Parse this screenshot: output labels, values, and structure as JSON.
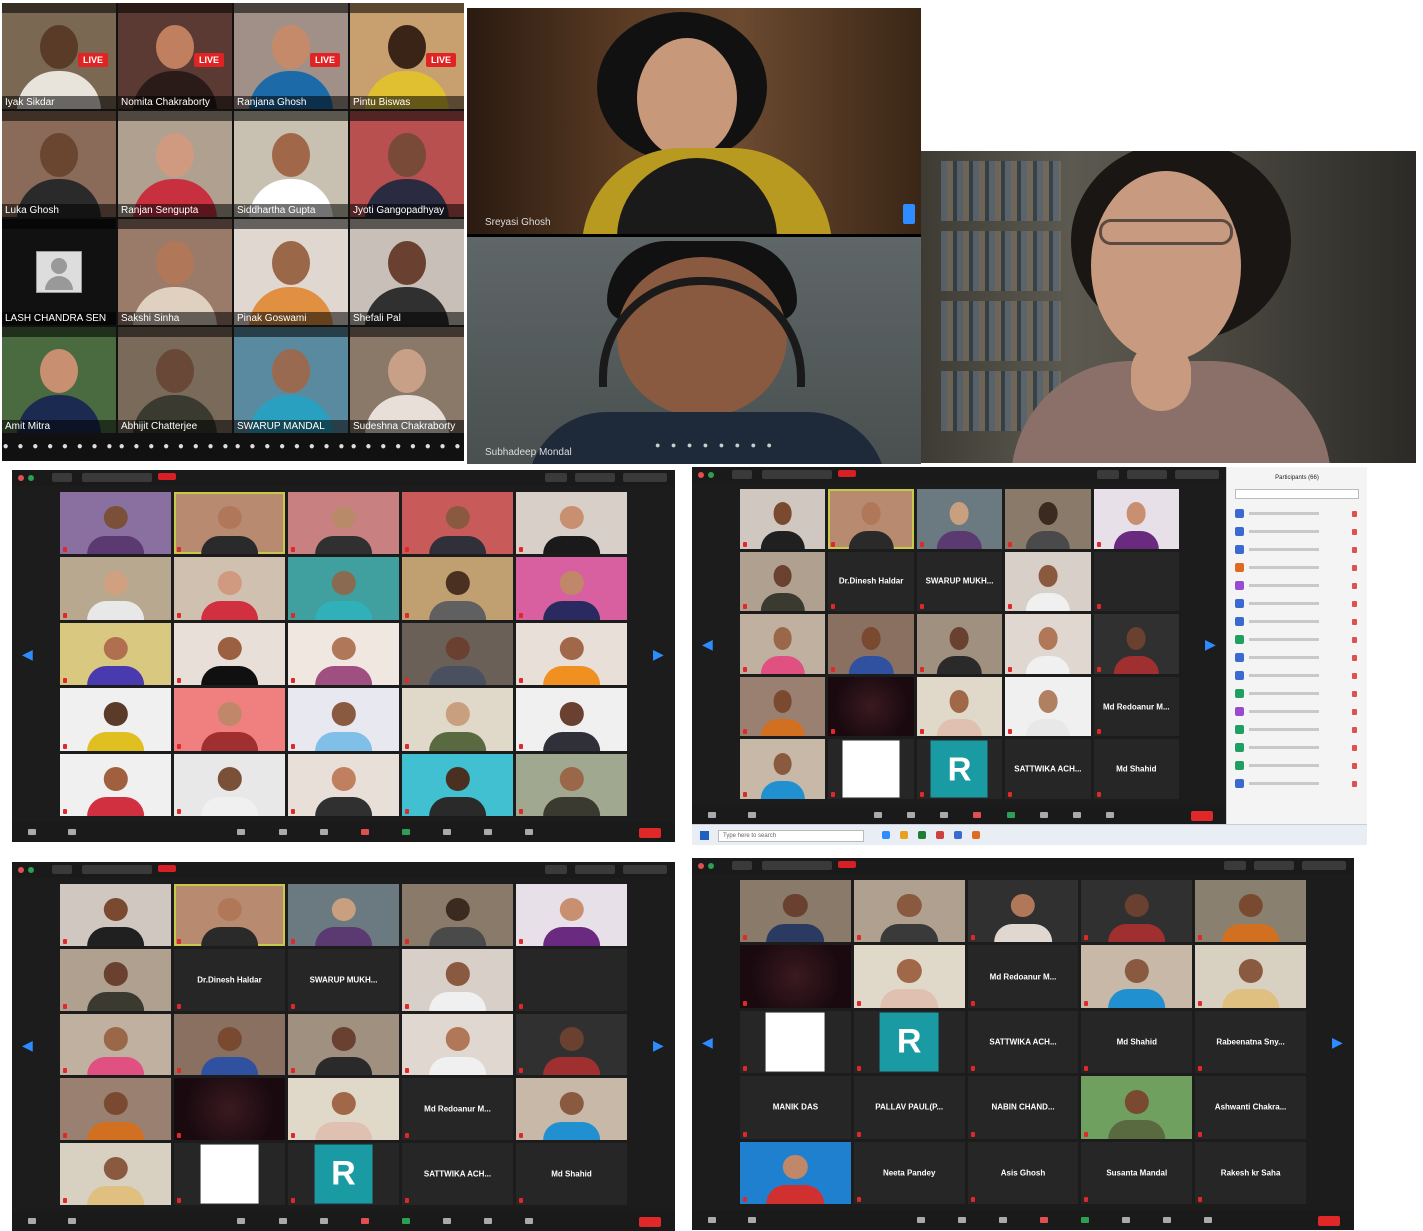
{
  "mobile_grid": {
    "tiles": [
      {
        "name": "Iyak Sikdar",
        "live": "LIVE",
        "bg": "#7a6852",
        "skin": "#5a3b28",
        "shirt": "#e8e4dc"
      },
      {
        "name": "Nomita Chakraborty",
        "live": "LIVE",
        "bg": "#5a3a32",
        "skin": "#c08060",
        "shirt": "#2a1a18"
      },
      {
        "name": "Ranjana Ghosh",
        "live": "LIVE",
        "bg": "#a09088",
        "skin": "#c58a6a",
        "shirt": "#1c6aa8"
      },
      {
        "name": "Pintu Biswas",
        "live": "LIVE",
        "bg": "#c8a070",
        "skin": "#3a2418",
        "shirt": "#e0c030"
      },
      {
        "name": "Luka Ghosh",
        "live": "",
        "bg": "#8a6a58",
        "skin": "#6a4530",
        "shirt": "#2a2a2a"
      },
      {
        "name": "Ranjan Sengupta",
        "live": "",
        "bg": "#b0a090",
        "skin": "#d09a80",
        "shirt": "#c83040"
      },
      {
        "name": "Siddhartha Gupta",
        "live": "",
        "bg": "#c8c0b0",
        "skin": "#a06848",
        "shirt": "#ffffff"
      },
      {
        "name": "Jyoti Gangopadhyay",
        "live": "",
        "bg": "#b85050",
        "skin": "#7a4a38",
        "shirt": "#2a2a40"
      },
      {
        "name": "LASH CHANDRA SEN",
        "live": "",
        "bg": "#111111",
        "skin": "",
        "shirt": "",
        "avatar": true
      },
      {
        "name": "Sakshi Sinha",
        "live": "",
        "bg": "#9a7a68",
        "skin": "#b07858",
        "shirt": "#e0d0c0"
      },
      {
        "name": "Pinak Goswami",
        "live": "",
        "bg": "#e0d8d0",
        "skin": "#9a6848",
        "shirt": "#e09040"
      },
      {
        "name": "Shefali Pal",
        "live": "",
        "bg": "#c8c0b8",
        "skin": "#6a4030",
        "shirt": "#303030"
      },
      {
        "name": "Amit Mitra",
        "live": "",
        "bg": "#4a6a40",
        "skin": "#c89070",
        "shirt": "#1a2a50"
      },
      {
        "name": "Abhijit Chatterjee",
        "live": "",
        "bg": "#7a6a5a",
        "skin": "#6a4838",
        "shirt": "#3a3a30"
      },
      {
        "name": "SWARUP MANDAL",
        "live": "",
        "bg": "#5a8aa0",
        "skin": "#9a6a50",
        "shirt": "#2aa0c0"
      },
      {
        "name": "Sudeshna Chakraborty",
        "live": "",
        "bg": "#8a7868",
        "skin": "#c8a088",
        "shirt": "#e8e0d8"
      }
    ],
    "footer_dots": [
      "● ● ● ● ● ● ● ● ●",
      "● ● ● ● ● ● ● ● ●",
      "● ● ● ● ● ● ● ● ●",
      "● ● ● ● ● ● ● ● ●"
    ]
  },
  "speakers": {
    "top_name": "Sreyasi Ghosh",
    "bottom_name": "Subhadeep Mondal",
    "bottom_dots": "● ● ● ● ● ● ● ●"
  },
  "zoom_panels": [
    {
      "cols": 5,
      "rows": 5,
      "tiles": [
        {
          "type": "video",
          "bg": "#8a70a0",
          "skin": "#7a5038",
          "shirt": "#5a3a70"
        },
        {
          "type": "video",
          "bg": "#b88a70",
          "skin": "#b07858",
          "shirt": "#2a2a2a",
          "active": true
        },
        {
          "type": "video",
          "bg": "#c88080",
          "skin": "#b88a6a",
          "shirt": "#303030"
        },
        {
          "type": "video",
          "bg": "#c85a5a",
          "skin": "#8a5a40",
          "shirt": "#30303a"
        },
        {
          "type": "video",
          "bg": "#d8d0c8",
          "skin": "#c89070",
          "shirt": "#1a1a1a"
        },
        {
          "type": "video",
          "bg": "#b8a890",
          "skin": "#d0a080",
          "shirt": "#e8e8e8"
        },
        {
          "type": "video",
          "bg": "#d0c0b0",
          "skin": "#d09a80",
          "shirt": "#d03040"
        },
        {
          "type": "video",
          "bg": "#40a0a0",
          "skin": "#8a6a50",
          "shirt": "#30b0b8"
        },
        {
          "type": "video",
          "bg": "#c0a070",
          "skin": "#4a3020",
          "shirt": "#606060"
        },
        {
          "type": "video",
          "bg": "#d860a0",
          "skin": "#c08868",
          "shirt": "#2a2a60"
        },
        {
          "type": "video",
          "bg": "#d8c880",
          "skin": "#b07050",
          "shirt": "#4a3ab0"
        },
        {
          "type": "video",
          "bg": "#e8e0d8",
          "skin": "#9a6040",
          "shirt": "#101010"
        },
        {
          "type": "video",
          "bg": "#f0e8e0",
          "skin": "#b07858",
          "shirt": "#a05080"
        },
        {
          "type": "video",
          "bg": "#6a6058",
          "skin": "#6a4030",
          "shirt": "#4a5060"
        },
        {
          "type": "video",
          "bg": "#e8e0d8",
          "skin": "#a06848",
          "shirt": "#f09020"
        },
        {
          "type": "video",
          "bg": "#f0f0f0",
          "skin": "#5a3a28",
          "shirt": "#e0c020"
        },
        {
          "type": "video",
          "bg": "#f08080",
          "skin": "#c08868",
          "shirt": "#a03030"
        },
        {
          "type": "video",
          "bg": "#e8e8f0",
          "skin": "#8a5a40",
          "shirt": "#80c0e8"
        },
        {
          "type": "video",
          "bg": "#e0d8c8",
          "skin": "#c8a080",
          "shirt": "#5a6a40"
        },
        {
          "type": "video",
          "bg": "#f0f0f0",
          "skin": "#6a4030",
          "shirt": "#30303a"
        },
        {
          "type": "video",
          "bg": "#f0f0f0",
          "skin": "#a06040",
          "shirt": "#d03040"
        },
        {
          "type": "video",
          "bg": "#e8e8e8",
          "skin": "#7a5038",
          "shirt": "#f0f0f0"
        },
        {
          "type": "video",
          "bg": "#e8e0d8",
          "skin": "#c08060",
          "shirt": "#303030"
        },
        {
          "type": "video",
          "bg": "#40c0d0",
          "skin": "#4a3020",
          "shirt": "#2a2a2a"
        },
        {
          "type": "video",
          "bg": "#a0a890",
          "skin": "#9a6848",
          "shirt": "#3a3a30"
        }
      ]
    },
    {
      "cols": 5,
      "rows": 5,
      "side_panel": true,
      "tiles": [
        {
          "type": "video",
          "bg": "#d0c8c0",
          "skin": "#7a4a30",
          "shirt": "#202020"
        },
        {
          "type": "video",
          "bg": "#b88a70",
          "skin": "#b07858",
          "shirt": "#2a2a2a",
          "active": true
        },
        {
          "type": "video",
          "bg": "#6a7a80",
          "skin": "#c8a080",
          "shirt": "#5a3a70"
        },
        {
          "type": "video",
          "bg": "#8a7a6a",
          "skin": "#3a2a20",
          "shirt": "#4a4a4a"
        },
        {
          "type": "video",
          "bg": "#e8e0e8",
          "skin": "#c89070",
          "shirt": "#6a2a80"
        },
        {
          "type": "video",
          "bg": "#b0a090",
          "skin": "#6a4030",
          "shirt": "#3a3a30"
        },
        {
          "type": "name",
          "label": "Dr.Dinesh Haldar"
        },
        {
          "type": "name",
          "label": "SWARUP MUKH..."
        },
        {
          "type": "video",
          "bg": "#d8d0c8",
          "skin": "#8a5a40",
          "shirt": "#f0f0f0"
        },
        {
          "type": "empty"
        },
        {
          "type": "video",
          "bg": "#c0b0a0",
          "skin": "#9a6848",
          "shirt": "#e05080"
        },
        {
          "type": "video",
          "bg": "#8a7060",
          "skin": "#7a4a30",
          "shirt": "#3050a0"
        },
        {
          "type": "video",
          "bg": "#a09080",
          "skin": "#6a4030",
          "shirt": "#2a2a2a"
        },
        {
          "type": "video",
          "bg": "#e0d8d0",
          "skin": "#b07858",
          "shirt": "#f0f0f0"
        },
        {
          "type": "video",
          "bg": "#303030",
          "skin": "#6a4030",
          "shirt": "#a03030"
        },
        {
          "type": "video",
          "bg": "#9a8070",
          "skin": "#7a4a30",
          "shirt": "#d07020"
        },
        {
          "type": "dark"
        },
        {
          "type": "video",
          "bg": "#e0d8c8",
          "skin": "#a06848",
          "shirt": "#e0c0b0"
        },
        {
          "type": "video",
          "bg": "#f0f0f0",
          "skin": "#b08060",
          "shirt": "#e8e8e8"
        },
        {
          "type": "name",
          "label": "Md Redoanur M..."
        },
        {
          "type": "video",
          "bg": "#c8b8a8",
          "skin": "#8a5a40",
          "shirt": "#2090d0"
        },
        {
          "type": "white"
        },
        {
          "type": "r",
          "label": "R"
        },
        {
          "type": "name",
          "label": "SATTWIKA ACH..."
        },
        {
          "type": "name",
          "label": "Md Shahid"
        }
      ],
      "panel": {
        "title": "Participants (66)",
        "search_placeholder": "Find a participant",
        "rows": [
          "#3a6ad0",
          "#3a6ad0",
          "#3a6ad0",
          "#e06a20",
          "#9a4ad0",
          "#3a6ad0",
          "#3a6ad0",
          "#20a060",
          "#3a6ad0",
          "#3a6ad0",
          "#20a060",
          "#9a4ad0",
          "#20a060",
          "#20a060",
          "#20a060",
          "#3a6ad0"
        ]
      },
      "taskbar": {
        "search": "Type here to search",
        "apps": [
          "#2d8cff",
          "#e8a020",
          "#1e7e34",
          "#d04040",
          "#3a6ad0",
          "#e06a20"
        ]
      }
    },
    {
      "cols": 5,
      "rows": 5,
      "tiles": [
        {
          "type": "video",
          "bg": "#d0c8c0",
          "skin": "#7a4a30",
          "shirt": "#202020"
        },
        {
          "type": "video",
          "bg": "#b88a70",
          "skin": "#b07858",
          "shirt": "#2a2a2a",
          "active": true
        },
        {
          "type": "video",
          "bg": "#6a7a80",
          "skin": "#c8a080",
          "shirt": "#5a3a70"
        },
        {
          "type": "video",
          "bg": "#8a7a6a",
          "skin": "#3a2a20",
          "shirt": "#4a4a4a"
        },
        {
          "type": "video",
          "bg": "#e8e0e8",
          "skin": "#c89070",
          "shirt": "#6a2a80"
        },
        {
          "type": "video",
          "bg": "#b0a090",
          "skin": "#6a4030",
          "shirt": "#3a3a30"
        },
        {
          "type": "name",
          "label": "Dr.Dinesh Haldar"
        },
        {
          "type": "name",
          "label": "SWARUP MUKH..."
        },
        {
          "type": "video",
          "bg": "#d8d0c8",
          "skin": "#8a5a40",
          "shirt": "#f0f0f0"
        },
        {
          "type": "empty"
        },
        {
          "type": "video",
          "bg": "#c0b0a0",
          "skin": "#9a6848",
          "shirt": "#e05080"
        },
        {
          "type": "video",
          "bg": "#8a7060",
          "skin": "#7a4a30",
          "shirt": "#3050a0"
        },
        {
          "type": "video",
          "bg": "#a09080",
          "skin": "#6a4030",
          "shirt": "#2a2a2a"
        },
        {
          "type": "video",
          "bg": "#e0d8d0",
          "skin": "#b07858",
          "shirt": "#f0f0f0"
        },
        {
          "type": "video",
          "bg": "#303030",
          "skin": "#6a4030",
          "shirt": "#a03030"
        },
        {
          "type": "video",
          "bg": "#9a8070",
          "skin": "#7a4a30",
          "shirt": "#d07020"
        },
        {
          "type": "dark"
        },
        {
          "type": "video",
          "bg": "#e0d8c8",
          "skin": "#a06848",
          "shirt": "#e0c0b0"
        },
        {
          "type": "name",
          "label": "Md Redoanur M..."
        },
        {
          "type": "video",
          "bg": "#c8b8a8",
          "skin": "#8a5a40",
          "shirt": "#2090d0"
        },
        {
          "type": "video",
          "bg": "#d8d0c0",
          "skin": "#8a5a40",
          "shirt": "#e0c080"
        },
        {
          "type": "white"
        },
        {
          "type": "r",
          "label": "R"
        },
        {
          "type": "name",
          "label": "SATTWIKA ACH..."
        },
        {
          "type": "name",
          "label": "Md Shahid"
        }
      ]
    },
    {
      "cols": 5,
      "rows": 5,
      "tiles": [
        {
          "type": "video",
          "bg": "#8a7a6a",
          "skin": "#6a4030",
          "shirt": "#2a3a60"
        },
        {
          "type": "video",
          "bg": "#b0a090",
          "skin": "#8a5a40",
          "shirt": "#3a3a3a"
        },
        {
          "type": "video",
          "bg": "#303030",
          "skin": "#b07858",
          "shirt": "#e0d8d0"
        },
        {
          "type": "video",
          "bg": "#303030",
          "skin": "#6a4030",
          "shirt": "#a03030"
        },
        {
          "type": "video",
          "bg": "#8a8070",
          "skin": "#7a4a30",
          "shirt": "#d07020"
        },
        {
          "type": "dark"
        },
        {
          "type": "video",
          "bg": "#e0d8c8",
          "skin": "#a06848",
          "shirt": "#e0c0b0"
        },
        {
          "type": "name",
          "label": "Md Redoanur M..."
        },
        {
          "type": "video",
          "bg": "#c8b8a8",
          "skin": "#8a5a40",
          "shirt": "#2090d0"
        },
        {
          "type": "video",
          "bg": "#d8d0c0",
          "skin": "#8a5a40",
          "shirt": "#e0c080"
        },
        {
          "type": "white"
        },
        {
          "type": "r",
          "label": "R"
        },
        {
          "type": "name",
          "label": "SATTWIKA ACH..."
        },
        {
          "type": "name",
          "label": "Md Shahid"
        },
        {
          "type": "name",
          "label": "Rabeenatna Sny..."
        },
        {
          "type": "name",
          "label": "MANIK DAS"
        },
        {
          "type": "name",
          "label": "PALLAV PAUL(P..."
        },
        {
          "type": "name",
          "label": "NABIN CHAND..."
        },
        {
          "type": "video",
          "bg": "#70a060",
          "skin": "#7a4a30",
          "shirt": "#5a6a40"
        },
        {
          "type": "name",
          "label": "Ashwanti Chakra..."
        },
        {
          "type": "video",
          "bg": "#2080d0",
          "skin": "#c08868",
          "shirt": "#d03030"
        },
        {
          "type": "name",
          "label": "Neeta Pandey"
        },
        {
          "type": "name",
          "label": "Asis Ghosh"
        },
        {
          "type": "name",
          "label": "Susanta Mandal"
        },
        {
          "type": "name",
          "label": "Rakesh kr Saha"
        }
      ]
    }
  ]
}
